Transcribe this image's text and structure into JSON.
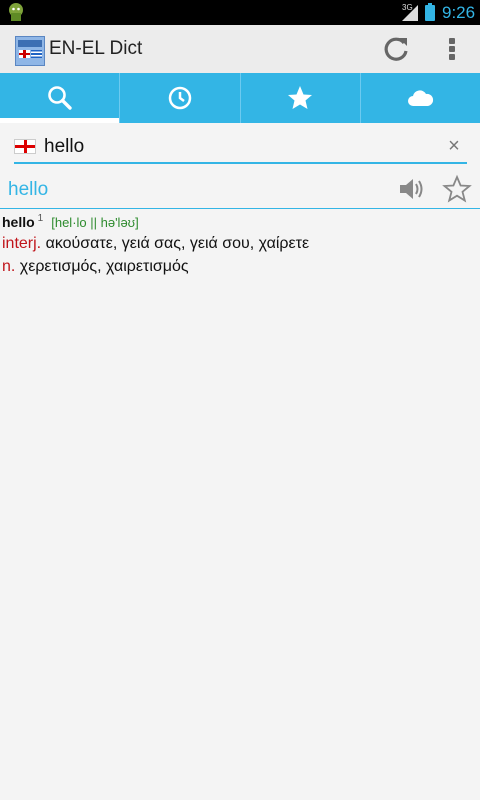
{
  "status_bar": {
    "network": "3G",
    "time": "9:26"
  },
  "app": {
    "title": "EN-EL Dict"
  },
  "tabs": [
    {
      "name": "search",
      "icon": "search-icon"
    },
    {
      "name": "history",
      "icon": "clock-icon"
    },
    {
      "name": "favorites",
      "icon": "star-icon"
    },
    {
      "name": "cloud",
      "icon": "cloud-icon"
    }
  ],
  "search": {
    "value": "hello",
    "clear_label": "×"
  },
  "result": {
    "word": "hello"
  },
  "entry": {
    "headword": "hello",
    "index": "1",
    "pronunciation": "[hel·lo || hə'ləʊ]",
    "senses": [
      {
        "pos": "interj.",
        "text": "ακούσατε, γειά σας, γειά σου, χαίρετε"
      },
      {
        "pos": "n.",
        "text": "χερετισμός, χαιρετισμός"
      }
    ]
  },
  "colors": {
    "accent": "#33b5e5",
    "pos": "#c0141a",
    "pron": "#2e8b2e"
  }
}
